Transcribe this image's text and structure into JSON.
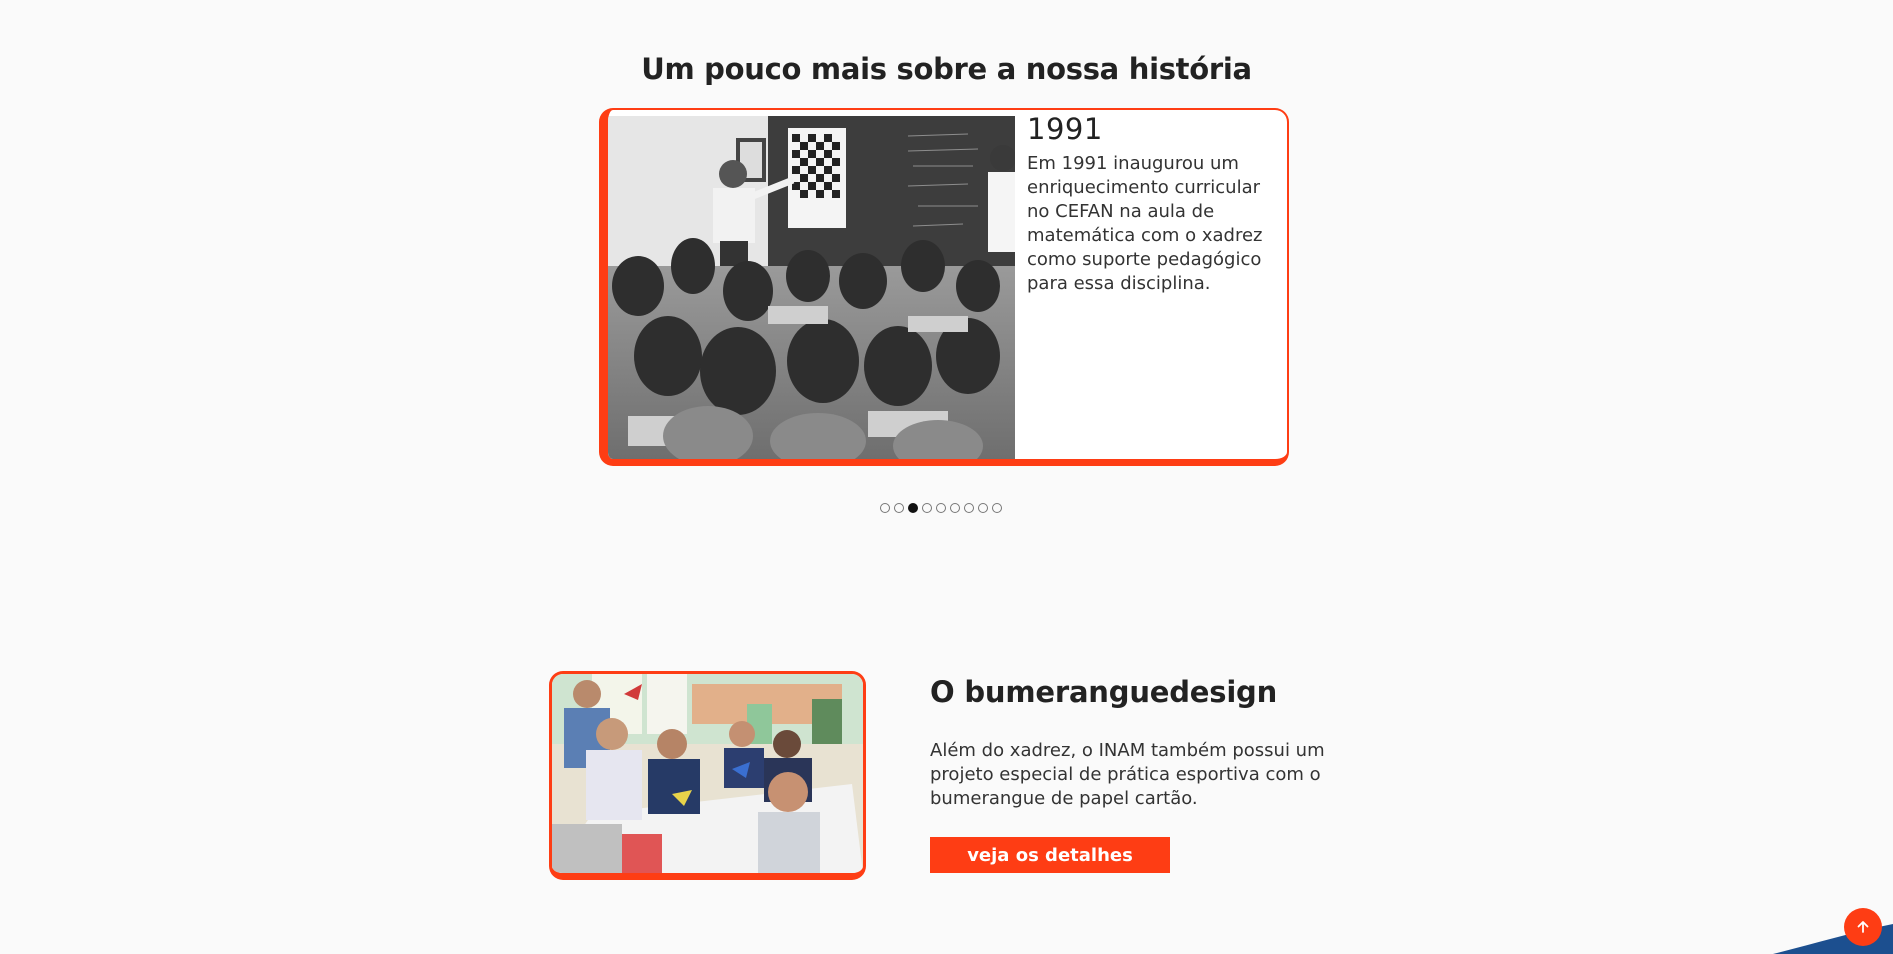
{
  "history": {
    "title": "Um pouco mais sobre a nossa história",
    "slide": {
      "year": "1991",
      "text": "Em 1991 inaugurou um enriquecimento curricular no CEFAN na aula de matemática com o xadrez como suporte pedagógico para essa disciplina."
    },
    "dots": [
      {
        "active": false
      },
      {
        "active": false
      },
      {
        "active": true
      },
      {
        "active": false
      },
      {
        "active": false
      },
      {
        "active": false
      },
      {
        "active": false
      },
      {
        "active": false
      },
      {
        "active": false
      }
    ]
  },
  "boomerang": {
    "title": "O bumeranguedesign",
    "text": "Além do xadrez, o INAM também possui um projeto especial de prática esportiva com o bumerangue de papel cartão.",
    "button_label": "veja os detalhes"
  },
  "colors": {
    "accent": "#fe3d14",
    "wave_blue": "#1c4f8f",
    "background": "#fafafa"
  },
  "icons": {
    "scroll_top": "arrow-up-icon"
  }
}
